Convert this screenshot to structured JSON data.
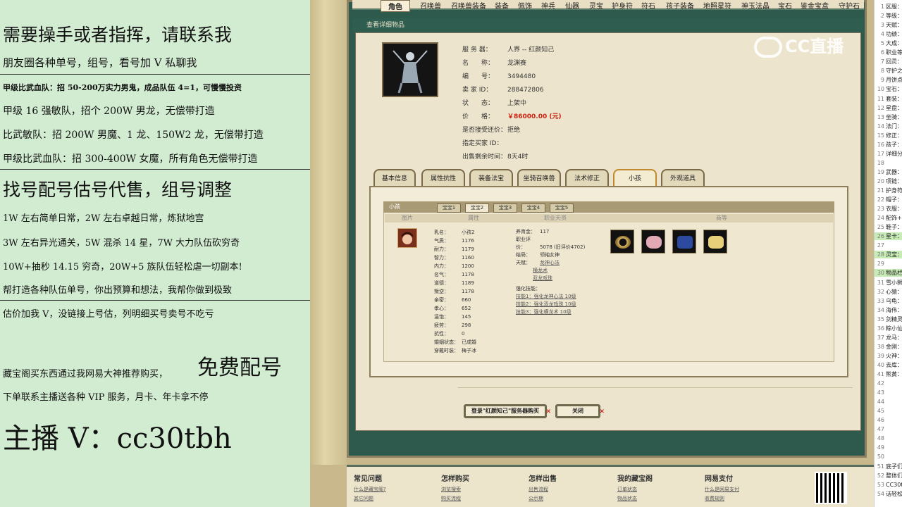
{
  "left_panel": {
    "lines": [
      "需要操手或者指挥，请联系我",
      "朋友圈各种单号，组号，看号加 V 私聊我",
      "甲级比武血队：招 50-200万实力男鬼，成品队伍 4=1，可慢慢投资",
      "甲级 16 强敏队，招个 200W 男龙，无偿带打造",
      "比武敏队：招 200W 男魔、1 龙、150W2 龙，无偿带打造",
      "甲级比武血队：招 300-400W 女魔，所有角色无偿带打造",
      "找号配号估号代售，组号调整",
      "1W 左右简单日常，2W 左右卓越日常，炼狱地宫",
      "3W 左右异光通关，5W 混杀 14 星，7W 大力队伍砍穷奇",
      "10W+抽秒 14.15 穷奇，20W+5 族队伍轻松虐一切副本!",
      "帮打造各种队伍单号，你出预算和想法，我帮你做到极致",
      "估价加我 V，没链接上号估，列明细买号卖号不吃亏",
      "藏宝阁买东西通过我网易大神推荐购买，",
      "免费配号",
      "下单联系主播送各种 VIP 服务，月卡、年卡拿不停",
      "主播 V：cc30tbh"
    ]
  },
  "top_nav": [
    "角色",
    "召唤兽",
    "召唤兽装备",
    "装备",
    "佩饰",
    "神兵",
    "仙器",
    "灵宝",
    "护身符",
    "符石",
    "孩子装备",
    "地照星符",
    "神玉法晶",
    "宝石",
    "鉴金宝盒",
    "守护石"
  ],
  "titlebar": "查看详细物品",
  "watermark": "CC直播",
  "item": {
    "fields": [
      {
        "k": "服 务 器：",
        "v": "人界 -- 红颜知己"
      },
      {
        "k": "名　　称：",
        "v": "龙渊赛"
      },
      {
        "k": "编　　号：",
        "v": "3494480"
      },
      {
        "k": "卖 家 ID：",
        "v": "288472806"
      },
      {
        "k": "状　　态：",
        "v": "上架中"
      },
      {
        "k": "价　　格：",
        "v": "￥86000.00 (元)"
      },
      {
        "k": "是否接受还价：",
        "v": "拒绝"
      },
      {
        "k": "指定买家 ID：",
        "v": ""
      },
      {
        "k": "出售剩余时间：",
        "v": "8天4时"
      }
    ]
  },
  "tabs": [
    "基本信息",
    "属性抗性",
    "装备法宝",
    "坐骑召唤兽",
    "法术修正",
    "小孩",
    "外观道具"
  ],
  "selected_tab": "小孩",
  "child_section": {
    "header": "小孩",
    "subtabs": [
      "宝宝1",
      "宝宝2",
      "宝宝3",
      "宝宝4",
      "宝宝5"
    ],
    "selected_subtab": "宝宝2",
    "columns": [
      "图片",
      "属性",
      "职业天资",
      "商等"
    ],
    "stats": [
      {
        "k": "乳名：",
        "v": "小孩2"
      },
      {
        "k": "气质：",
        "v": "1176"
      },
      {
        "k": "耐力：",
        "v": "1179"
      },
      {
        "k": "智力：",
        "v": "1160"
      },
      {
        "k": "内力：",
        "v": "1200"
      },
      {
        "k": "名气：",
        "v": "1178"
      },
      {
        "k": "道德：",
        "v": "1189"
      },
      {
        "k": "叛逆：",
        "v": "1178"
      },
      {
        "k": "亲密：",
        "v": "660"
      },
      {
        "k": "孝心：",
        "v": "652"
      },
      {
        "k": "温饱：",
        "v": "145"
      },
      {
        "k": "疲劳：",
        "v": "298"
      },
      {
        "k": "抗性：",
        "v": "0"
      },
      {
        "k": "婚姻状态：",
        "v": "已成婚"
      },
      {
        "k": "穿戴时装：",
        "v": "梅子冰"
      }
    ],
    "career": [
      {
        "k": "养育金：",
        "v": "117"
      },
      {
        "k": "职业评价：",
        "v": "5078 (旧评价4702)"
      },
      {
        "k": "结局：",
        "v": "领袖女神"
      },
      {
        "k": "天赋：",
        "v": "龙神心法"
      }
    ],
    "talent_links": [
      "横龙术",
      "双龙戏珠"
    ],
    "strengthen_label": "强化技能：",
    "skill_links": [
      "技能1：强化龙神心法 10级",
      "技能2：强化双龙戏珠 10级",
      "技能3：强化横龙术 10级"
    ]
  },
  "buttons": {
    "buy": "登录\"红颜知己\"服务器购买",
    "close": "关闭"
  },
  "footer": [
    {
      "title": "常见问题",
      "links": [
        "什么是藏宝阁?",
        "其它问题"
      ]
    },
    {
      "title": "怎样购买",
      "links": [
        "浏览搜索",
        "购买流程"
      ]
    },
    {
      "title": "怎样出售",
      "links": [
        "出售流程",
        "公示期"
      ]
    },
    {
      "title": "我的藏宝阁",
      "links": [
        "订单状态",
        "物品状态"
      ]
    },
    {
      "title": "网易支付",
      "links": [
        "什么是网易支付",
        "收费规则"
      ]
    }
  ],
  "right_sidebar": [
    {
      "n": "1",
      "t": "区服："
    },
    {
      "n": "2",
      "t": "等级："
    },
    {
      "n": "3",
      "t": "天赋："
    },
    {
      "n": "4",
      "t": "功绩："
    },
    {
      "n": "5",
      "t": "大成："
    },
    {
      "n": "6",
      "t": "职业等"
    },
    {
      "n": "7",
      "t": "回灵："
    },
    {
      "n": "8",
      "t": "守护之"
    },
    {
      "n": "9",
      "t": "月饼点"
    },
    {
      "n": "10",
      "t": "宝石："
    },
    {
      "n": "11",
      "t": "套装："
    },
    {
      "n": "12",
      "t": "星盘："
    },
    {
      "n": "13",
      "t": "坐骑："
    },
    {
      "n": "14",
      "t": "法门："
    },
    {
      "n": "15",
      "t": "修正："
    },
    {
      "n": "16",
      "t": "孩子："
    },
    {
      "n": "17",
      "t": "详细分"
    },
    {
      "n": "18",
      "t": ""
    },
    {
      "n": "19",
      "t": "武器："
    },
    {
      "n": "20",
      "t": "项链："
    },
    {
      "n": "21",
      "t": "护身符"
    },
    {
      "n": "22",
      "t": "帽子："
    },
    {
      "n": "23",
      "t": "衣服："
    },
    {
      "n": "24",
      "t": "配饰+"
    },
    {
      "n": "25",
      "t": "鞋子："
    },
    {
      "n": "26",
      "t": "星卡：",
      "hl": true
    },
    {
      "n": "27",
      "t": ""
    },
    {
      "n": "28",
      "t": "灵宝：",
      "hl": true
    },
    {
      "n": "29",
      "t": ""
    },
    {
      "n": "30",
      "t": "物品栏",
      "hl": true
    },
    {
      "n": "31",
      "t": "雪小狮"
    },
    {
      "n": "32",
      "t": "心猿："
    },
    {
      "n": "33",
      "t": "乌龟："
    },
    {
      "n": "34",
      "t": "海伟："
    },
    {
      "n": "35",
      "t": "剑精灵"
    },
    {
      "n": "36",
      "t": "粽小仙"
    },
    {
      "n": "37",
      "t": "龙马："
    },
    {
      "n": "38",
      "t": "金刚："
    },
    {
      "n": "39",
      "t": "火神："
    },
    {
      "n": "40",
      "t": "去库："
    },
    {
      "n": "41",
      "t": "熊黄："
    },
    {
      "n": "42",
      "t": ""
    },
    {
      "n": "43",
      "t": ""
    },
    {
      "n": "44",
      "t": ""
    },
    {
      "n": "45",
      "t": ""
    },
    {
      "n": "46",
      "t": ""
    },
    {
      "n": "47",
      "t": ""
    },
    {
      "n": "48",
      "t": ""
    },
    {
      "n": "49",
      "t": ""
    },
    {
      "n": "50",
      "t": ""
    },
    {
      "n": "51",
      "t": "底子们"
    },
    {
      "n": "52",
      "t": "整体们"
    },
    {
      "n": "53",
      "t": "CC30t"
    },
    {
      "n": "54",
      "t": "话轻松"
    }
  ]
}
